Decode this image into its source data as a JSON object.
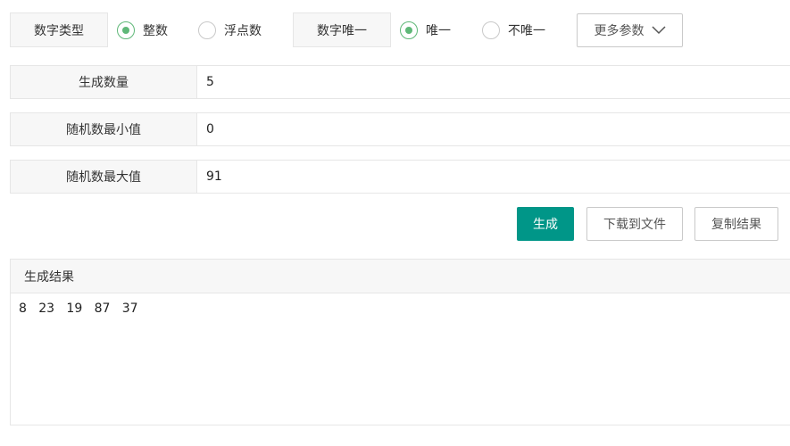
{
  "options": {
    "number_type_label": "数字类型",
    "integer_label": "整数",
    "float_label": "浮点数",
    "unique_label": "数字唯一",
    "unique_yes_label": "唯一",
    "unique_no_label": "不唯一",
    "more_params_label": "更多参数"
  },
  "fields": {
    "count_label": "生成数量",
    "count_value": "5",
    "min_label": "随机数最小值",
    "min_value": "0",
    "max_label": "随机数最大值",
    "max_value": "91"
  },
  "actions": {
    "generate_label": "生成",
    "download_label": "下载到文件",
    "copy_label": "复制结果"
  },
  "result": {
    "title": "生成结果",
    "content": "8   23   19   87   37"
  },
  "colors": {
    "accent": "#009688",
    "radio_checked": "#5fb878"
  }
}
